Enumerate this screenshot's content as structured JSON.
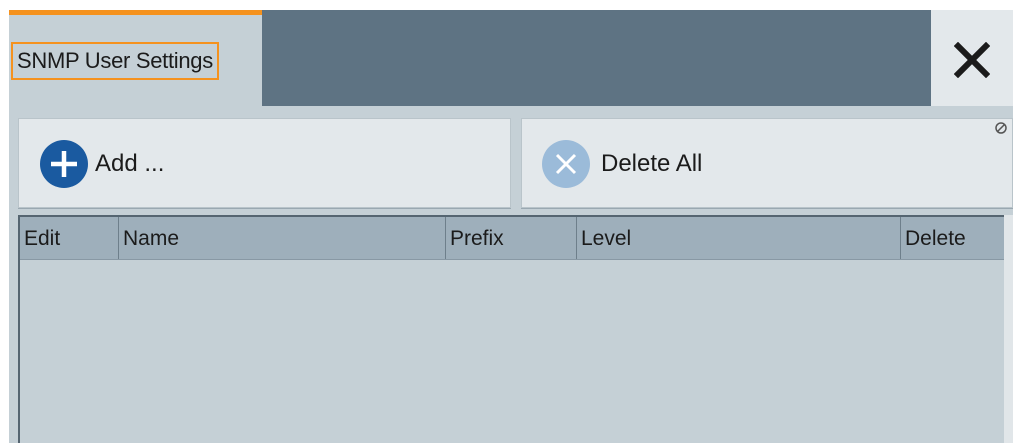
{
  "dialog": {
    "title": "SNMP User Settings",
    "close_icon": "close-icon"
  },
  "toolbar": {
    "add_label": "Add ...",
    "add_icon": "plus-circle-icon",
    "delete_all_label": "Delete All",
    "delete_all_icon": "x-circle-icon",
    "delete_all_state_icon": "disabled-icon"
  },
  "table": {
    "columns": [
      "Edit",
      "Name",
      "Prefix",
      "Level",
      "Delete"
    ],
    "rows": []
  },
  "colors": {
    "accent": "#f5921e",
    "header_bg": "#5e7383",
    "add_icon_bg": "#1a5aa0",
    "delete_icon_bg": "#9bbbd9",
    "panel_bg": "#c5d0d6"
  }
}
